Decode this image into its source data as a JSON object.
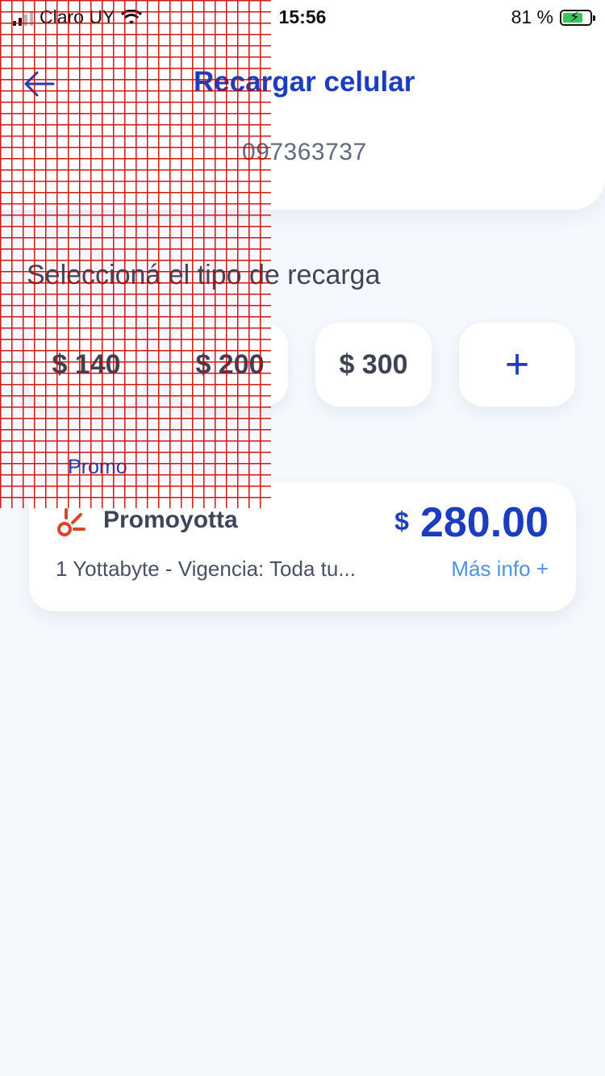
{
  "status_bar": {
    "carrier": "Claro UY",
    "time": "15:56",
    "battery_percent": "81 %",
    "battery_level": 0.81,
    "colors": {
      "battery_fill": "#35c759"
    }
  },
  "header": {
    "back_icon": "arrow-left-icon",
    "title": "Recargar celular",
    "phone_number": "097363737"
  },
  "recharge": {
    "section_label": "Seleccioná el tipo de recarga",
    "amounts": [
      "$ 140",
      "$ 200",
      "$ 300"
    ],
    "add_label": "+"
  },
  "promo": {
    "label": "Promo",
    "icon": "promo-burst-icon",
    "name": "Promoyotta",
    "currency": "$",
    "price": "280.00",
    "description": "1 Yottabyte - Vigencia: Toda tu...",
    "more_info": "Más info +"
  },
  "colors": {
    "accent": "#1c3ebe",
    "link": "#4e92e0",
    "promo_icon": "#d9452b",
    "background": "#f5f8fd"
  }
}
